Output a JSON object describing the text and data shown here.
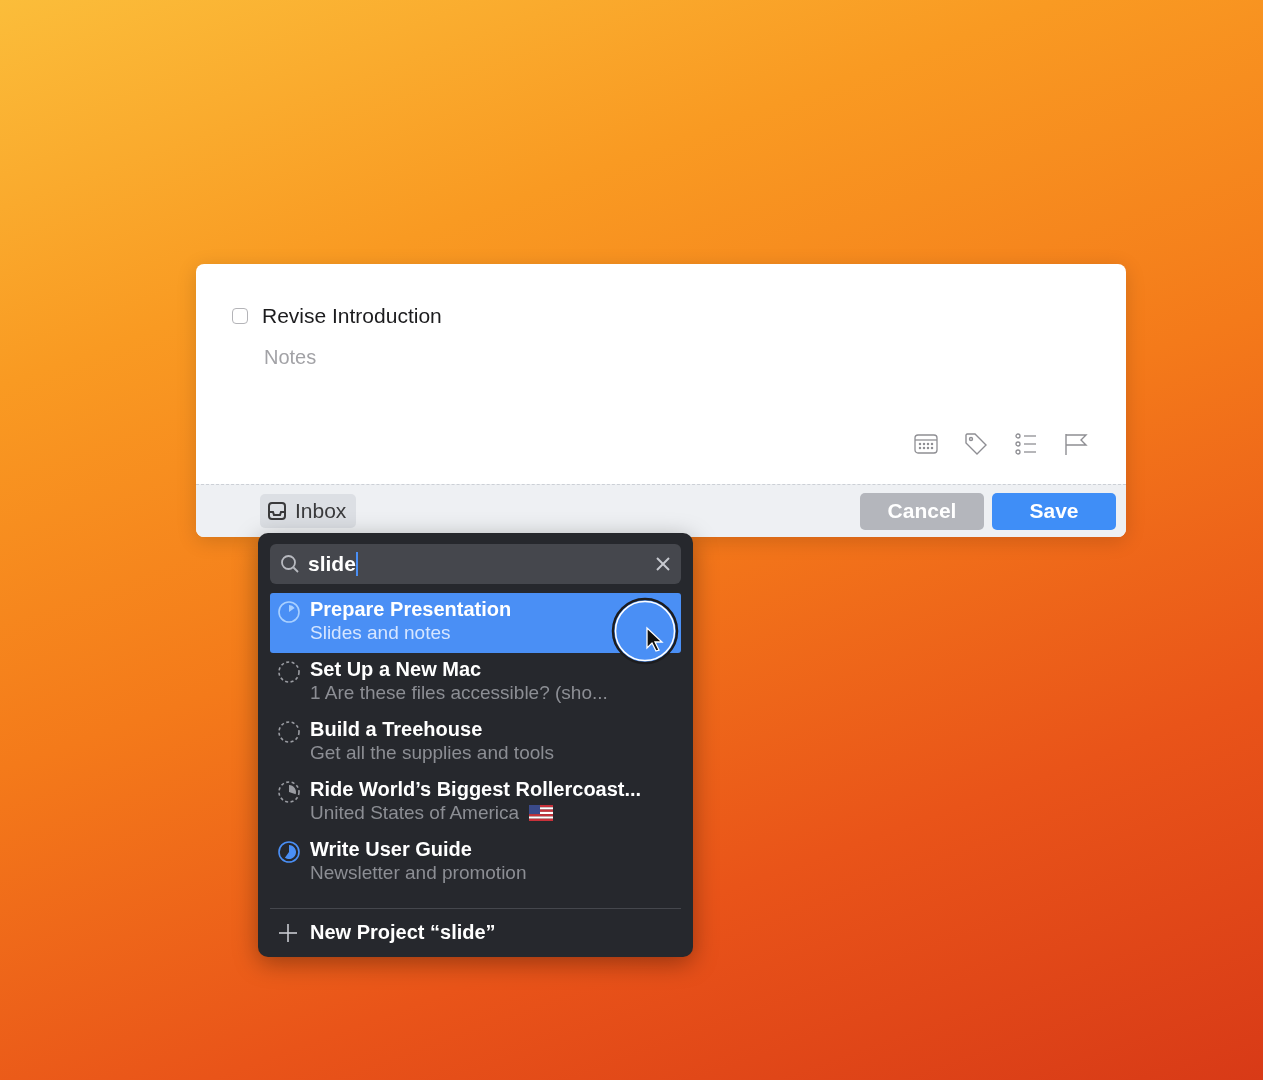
{
  "task": {
    "title": "Revise Introduction",
    "checked": false,
    "notes": {
      "placeholder": "Notes"
    }
  },
  "footer": {
    "project": "Inbox",
    "buttons": [
      {
        "label": "Cancel",
        "kind": "secondary"
      },
      {
        "label": "Save",
        "kind": "primary"
      }
    ]
  },
  "picker": {
    "search": {
      "value": "slide"
    },
    "projects": [
      {
        "title": "Prepare Presentation",
        "subtitle": "Slides and notes",
        "selected": true,
        "active": true,
        "kind": "sliver",
        "flag": false
      },
      {
        "title": "Set Up a New Mac",
        "subtitle": "1 Are these files accessible? (sho...",
        "selected": false,
        "active": false,
        "kind": "empty",
        "flag": false
      },
      {
        "title": "Build a Treehouse",
        "subtitle": "Get all the supplies and tools",
        "selected": false,
        "active": false,
        "kind": "empty",
        "flag": false
      },
      {
        "title": "Ride World’s Biggest Rollercoast...",
        "subtitle": "United States of America",
        "selected": false,
        "active": false,
        "kind": "third",
        "flag": true
      },
      {
        "title": "Write User Guide",
        "subtitle": "Newsletter and promotion",
        "selected": false,
        "active": true,
        "kind": "half",
        "flag": false
      }
    ],
    "new_project": "New Project “slide”"
  }
}
